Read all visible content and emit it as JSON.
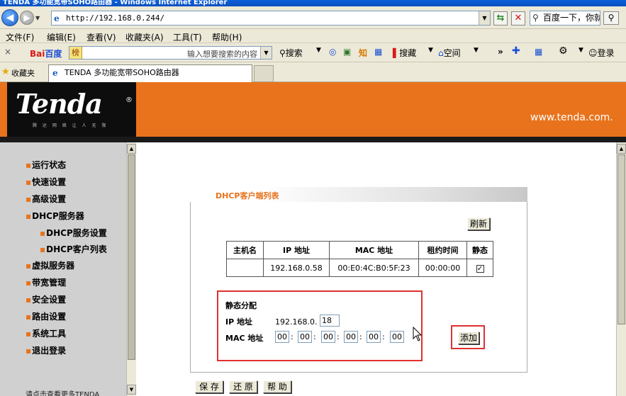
{
  "window": {
    "title": "TENDA 多功能宽带SOHO路由器 - Windows Internet Explorer"
  },
  "address_bar": {
    "url": "http://192.168.0.244/",
    "search_text": "百度一下，你就"
  },
  "menu": [
    "文件(F)",
    "编辑(E)",
    "查看(V)",
    "收藏夹(A)",
    "工具(T)",
    "帮助(H)"
  ],
  "toolbar": {
    "close": "×",
    "baidu_logo_a": "Bai",
    "baidu_logo_b": "百度",
    "baidu_hist": "榜",
    "baidu_placeholder": "输入想要搜索的内容",
    "search": "搜索",
    "zhi": "知",
    "soucang": "搜藏",
    "kongjian": "空间",
    "more": "»",
    "login": "登录"
  },
  "favorites": {
    "label": "收藏夹",
    "tab_title": "TENDA 多功能宽带SOHO路由器"
  },
  "header": {
    "logo": "Tenda",
    "logo_reg": "®",
    "logo_sub": "腾 达 网 络 让 人 无 限",
    "site_url": "www.tenda.com."
  },
  "sidebar": {
    "items": [
      {
        "label": "运行状态"
      },
      {
        "label": "快速设置"
      },
      {
        "label": "高级设置"
      },
      {
        "label": "DHCP服务器"
      },
      {
        "label": "DHCP服务设置"
      },
      {
        "label": "DHCP客户列表"
      },
      {
        "label": "虚拟服务器"
      },
      {
        "label": "带宽管理"
      },
      {
        "label": "安全设置"
      },
      {
        "label": "路由设置"
      },
      {
        "label": "系统工具"
      },
      {
        "label": "退出登录"
      }
    ],
    "footer": "请点击查看更多TENDA"
  },
  "panel": {
    "title": "DHCP客户端列表",
    "refresh": "刷新",
    "columns": [
      "主机名",
      "IP 地址",
      "MAC 地址",
      "租约时间",
      "静态"
    ],
    "rows": [
      {
        "host": "",
        "ip": "192.168.0.58",
        "mac": "00:E0:4C:B0:5F:23",
        "lease": "00:00:00",
        "static": "✓"
      }
    ]
  },
  "static_alloc": {
    "title": "静态分配",
    "ip_label": "IP 地址",
    "ip_prefix": "192.168.0.",
    "ip_last": "18",
    "mac_label": "MAC 地址",
    "mac": [
      "00",
      "00",
      "00",
      "00",
      "00",
      "00"
    ],
    "add": "添加"
  },
  "actions": {
    "save": "保 存",
    "restore": "还 原",
    "help": "帮 助"
  }
}
